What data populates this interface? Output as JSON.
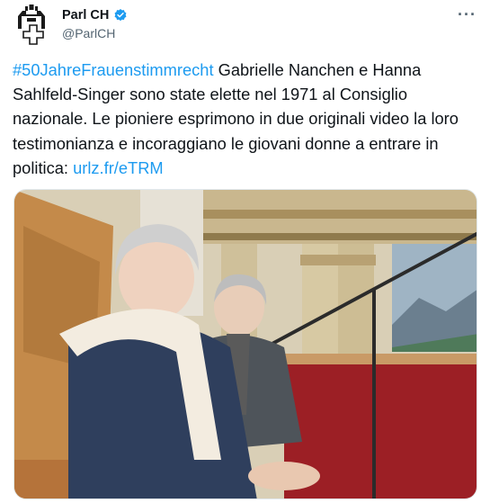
{
  "author": {
    "name": "Parl CH",
    "handle": "@ParlCH",
    "verified": true,
    "avatar_icon": "parliament-building-cross-icon"
  },
  "more_icon": "more-options-icon",
  "more_label": "···",
  "tweet": {
    "hashtag": "#50JahreFrauenstimmrecht",
    "body": " Gabrielle Nanchen e Hanna Sahlfeld-Singer sono state elette nel 1971 al Consiglio nazionale. Le pioniere  esprimono in due originali video la loro testimonianza e incoraggiano le giovani donne a entrare in politica: ",
    "link": "urlz.fr/eTRM"
  },
  "colors": {
    "link": "#1d9bf0",
    "verified": "#1d9bf0",
    "secondary_text": "#536471"
  }
}
